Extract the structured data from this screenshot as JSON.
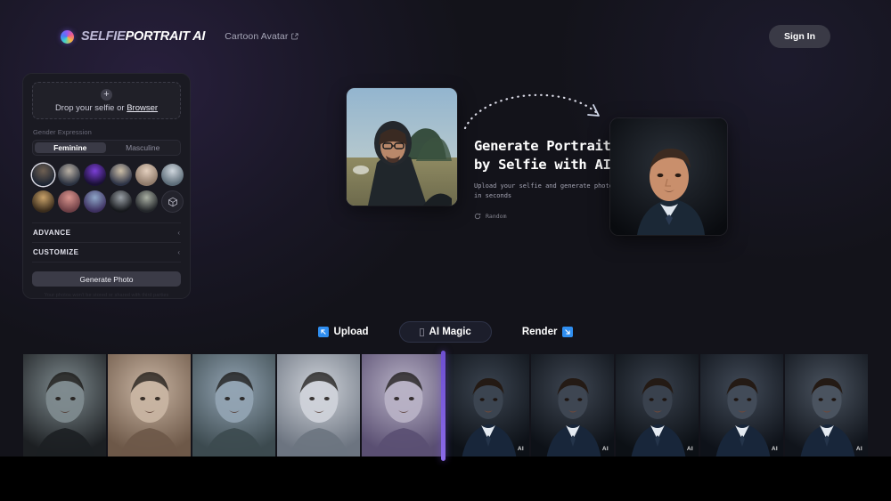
{
  "header": {
    "brand_part1": "SELFIE",
    "brand_part2": "PORTRAIT AI",
    "brand_logo_icon": "gradient-circle-icon",
    "nav_link": "Cartoon Avatar",
    "nav_link_icon": "external-link-icon",
    "signin_label": "Sign In"
  },
  "panel": {
    "dropzone": {
      "plus_icon": "plus-circle-icon",
      "text_before": "Drop your selfie or ",
      "browse_label": "Browser"
    },
    "gender_label": "Gender Expression",
    "gender_options": [
      {
        "label": "Feminine",
        "selected": true
      },
      {
        "label": "Masculine",
        "selected": false
      }
    ],
    "avatars": [
      {
        "name": "avatar-1",
        "selected": true,
        "c1": "#6f6052",
        "c2": "#1d2533"
      },
      {
        "name": "avatar-2",
        "selected": false,
        "c1": "#b9b0a4",
        "c2": "#2a3140"
      },
      {
        "name": "avatar-3",
        "selected": false,
        "c1": "#7b3fd6",
        "c2": "#1a1035"
      },
      {
        "name": "avatar-4",
        "selected": false,
        "c1": "#cdbfa8",
        "c2": "#2d3346"
      },
      {
        "name": "avatar-5",
        "selected": false,
        "c1": "#e3cfbe",
        "c2": "#8f7a6a"
      },
      {
        "name": "avatar-6",
        "selected": false,
        "c1": "#cfd6dd",
        "c2": "#5c6c78"
      },
      {
        "name": "avatar-7",
        "selected": false,
        "c1": "#c9a26a",
        "c2": "#3a2c1c"
      },
      {
        "name": "avatar-8",
        "selected": false,
        "c1": "#d9948e",
        "c2": "#6e3f45"
      },
      {
        "name": "avatar-9",
        "selected": false,
        "c1": "#8ea6c8",
        "c2": "#3d3060"
      },
      {
        "name": "avatar-10",
        "selected": false,
        "c1": "#9aa0a6",
        "c2": "#16181c"
      },
      {
        "name": "avatar-11",
        "selected": false,
        "c1": "#aab0a4",
        "c2": "#23262a"
      }
    ],
    "avatar_more_icon": "3d-cube-icon",
    "accordions": [
      {
        "label": "ADVANCE",
        "chevron": "‹"
      },
      {
        "label": "CUSTOMIZE",
        "chevron": "‹"
      }
    ],
    "generate_label": "Generate Photo",
    "fineprint": "Your photos won't be stored or shared with third parties"
  },
  "hero": {
    "title_line1": "Generate Portrait",
    "title_line2": "by Selfie with AI",
    "subtitle_line1": "Upload your selfie and generate photo",
    "subtitle_line2": "in seconds",
    "random_icon": "refresh-icon",
    "random_label": "Random",
    "arrow_icon": "dotted-curved-arrow-icon",
    "selfie_alt": "hero-selfie-photo",
    "result_alt": "hero-generated-portrait"
  },
  "steps": [
    {
      "label": "Upload",
      "icon": "arrow-up-left-icon",
      "active": false
    },
    {
      "label": "AI Magic",
      "icon": "sparkle-glyph-icon",
      "active": true
    },
    {
      "label": "Render",
      "icon": "arrow-down-right-icon",
      "active": false
    }
  ],
  "gallery": {
    "divider_name": "before-after-slider",
    "ai_watermark": "AI",
    "items": [
      {
        "name": "gallery-photo-1",
        "kind": "source",
        "c1": "#7f8b8f",
        "c2": "#1c1f22",
        "ai": false
      },
      {
        "name": "gallery-photo-2",
        "kind": "source",
        "c1": "#c9b5a3",
        "c2": "#6d5848",
        "ai": false
      },
      {
        "name": "gallery-photo-3",
        "kind": "source",
        "c1": "#93a4b3",
        "c2": "#3c4a4f",
        "ai": false
      },
      {
        "name": "gallery-photo-4",
        "kind": "source",
        "c1": "#cfd3da",
        "c2": "#6c7480",
        "ai": false
      },
      {
        "name": "gallery-photo-5",
        "kind": "source",
        "c1": "#b8b2c6",
        "c2": "#5a4f72",
        "ai": false
      },
      {
        "name": "gallery-photo-6",
        "kind": "ai",
        "c1": "#3b4450",
        "c2": "#0d1117",
        "ai": true
      },
      {
        "name": "gallery-photo-7",
        "kind": "ai",
        "c1": "#3e4652",
        "c2": "#0d1117",
        "ai": true
      },
      {
        "name": "gallery-photo-8",
        "kind": "ai",
        "c1": "#39414d",
        "c2": "#0c1015",
        "ai": true
      },
      {
        "name": "gallery-photo-9",
        "kind": "ai",
        "c1": "#424b58",
        "c2": "#0e1219",
        "ai": true
      },
      {
        "name": "gallery-photo-10",
        "kind": "ai",
        "c1": "#4a535f",
        "c2": "#10141b",
        "ai": true
      }
    ]
  },
  "colors": {
    "background": "#13131a",
    "panel": "#1a1a22",
    "accent_blue": "#2f8ef0",
    "accent_purple": "#7b5ade",
    "text_primary": "#ffffff",
    "text_muted": "#a7a7b8"
  }
}
